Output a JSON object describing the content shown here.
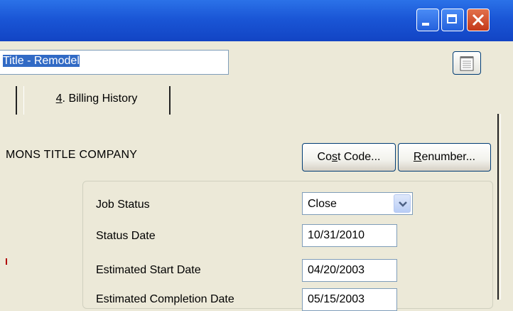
{
  "window": {
    "minimize_icon": "minimize-icon",
    "maximize_icon": "maximize-icon",
    "close_icon": "close-icon"
  },
  "header": {
    "job_name_value": "Title - Remodel",
    "notes_icon": "notepad-icon"
  },
  "tabs": [
    {
      "mnemonic": "4",
      "label": ". Billing History"
    }
  ],
  "main": {
    "company_name": "MONS TITLE COMPANY",
    "cost_code_pre": "Co",
    "cost_code_mn": "s",
    "cost_code_post": "t Code...",
    "renumber_mn": "R",
    "renumber_post": "enumber..."
  },
  "status": {
    "job_status_label": "Job Status",
    "job_status_value": "Close",
    "status_date_label": "Status Date",
    "status_date_value": "10/31/2010",
    "est_start_label": "Estimated Start Date",
    "est_start_value": "04/20/2003",
    "est_completion_label": "Estimated Completion Date",
    "est_completion_value": "05/15/2003"
  },
  "colors": {
    "titlebar": "#1a56d6",
    "close_button": "#c3381a",
    "selection": "#316ac5",
    "face": "#ece9d8"
  }
}
